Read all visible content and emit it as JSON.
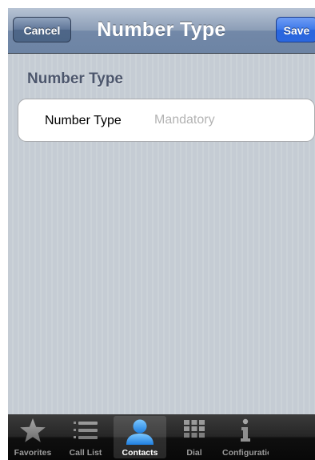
{
  "navbar": {
    "title": "Number Type",
    "cancel_label": "Cancel",
    "save_label": "Save"
  },
  "section": {
    "header": "Number Type"
  },
  "form": {
    "number_type_label": "Number Type",
    "number_type_value": "",
    "number_type_placeholder": "Mandatory"
  },
  "tabbar": {
    "items": [
      {
        "label": "Favorites",
        "icon": "star-icon",
        "active": false
      },
      {
        "label": "Call List",
        "icon": "list-icon",
        "active": false
      },
      {
        "label": "Contacts",
        "icon": "person-icon",
        "active": true
      },
      {
        "label": "Dial",
        "icon": "keypad-icon",
        "active": false
      },
      {
        "label": "Configuratio",
        "icon": "info-icon",
        "active": false
      }
    ]
  },
  "colors": {
    "nav_blue": "#6d84a4",
    "save_blue": "#2b67df",
    "background_stripe": "#c5ccd4",
    "active_tab_blue": "#2f8fe8"
  }
}
